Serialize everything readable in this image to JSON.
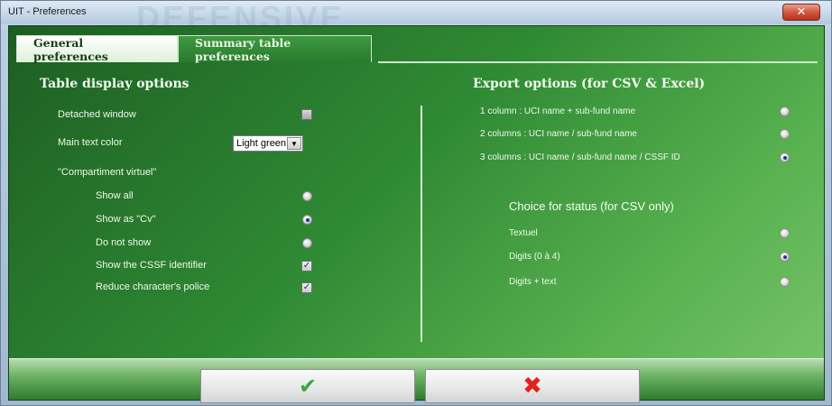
{
  "window": {
    "title": "UIT - Preferences",
    "background_watermark": "DEFENSIVE",
    "close_icon": "close-icon"
  },
  "tabs": [
    {
      "label": "General preferences",
      "active": true
    },
    {
      "label": "Summary table preferences",
      "active": false
    }
  ],
  "table_display": {
    "title": "Table display options",
    "detached_window": {
      "label": "Detached window",
      "checked": false
    },
    "main_text_color": {
      "label": "Main text color",
      "value": "Light green"
    },
    "compartiment_virtuel": {
      "label": "\"Compartiment virtuel\"",
      "options": [
        {
          "label": "Show all",
          "selected": false
        },
        {
          "label": "Show as \"Cv\"",
          "selected": true
        },
        {
          "label": "Do not show",
          "selected": false
        }
      ]
    },
    "show_cssf": {
      "label": "Show the CSSF identifier",
      "checked": true
    },
    "reduce_police": {
      "label": "Reduce character's police",
      "checked": true
    }
  },
  "export_options": {
    "title": "Export options (for CSV & Excel)",
    "options": [
      {
        "label": "1 column : UCI name + sub-fund name",
        "selected": false
      },
      {
        "label": "2 columns : UCI name / sub-fund name",
        "selected": false
      },
      {
        "label": "3 columns : UCI name / sub-fund name / CSSF ID",
        "selected": true
      }
    ]
  },
  "status_choice": {
    "title": "Choice for status (for CSV only)",
    "options": [
      {
        "label": "Textuel",
        "selected": false
      },
      {
        "label": "Digits (0 à 4)",
        "selected": true
      },
      {
        "label": "Digits + text",
        "selected": false
      }
    ]
  },
  "buttons": {
    "ok_icon": "checkmark-icon",
    "cancel_icon": "red-x-icon"
  },
  "colors": {
    "panel_green": "#2f8a34",
    "ok_green": "#3aa83a",
    "cancel_red": "#e0231c",
    "radio_selected": "#1d3b8f"
  }
}
